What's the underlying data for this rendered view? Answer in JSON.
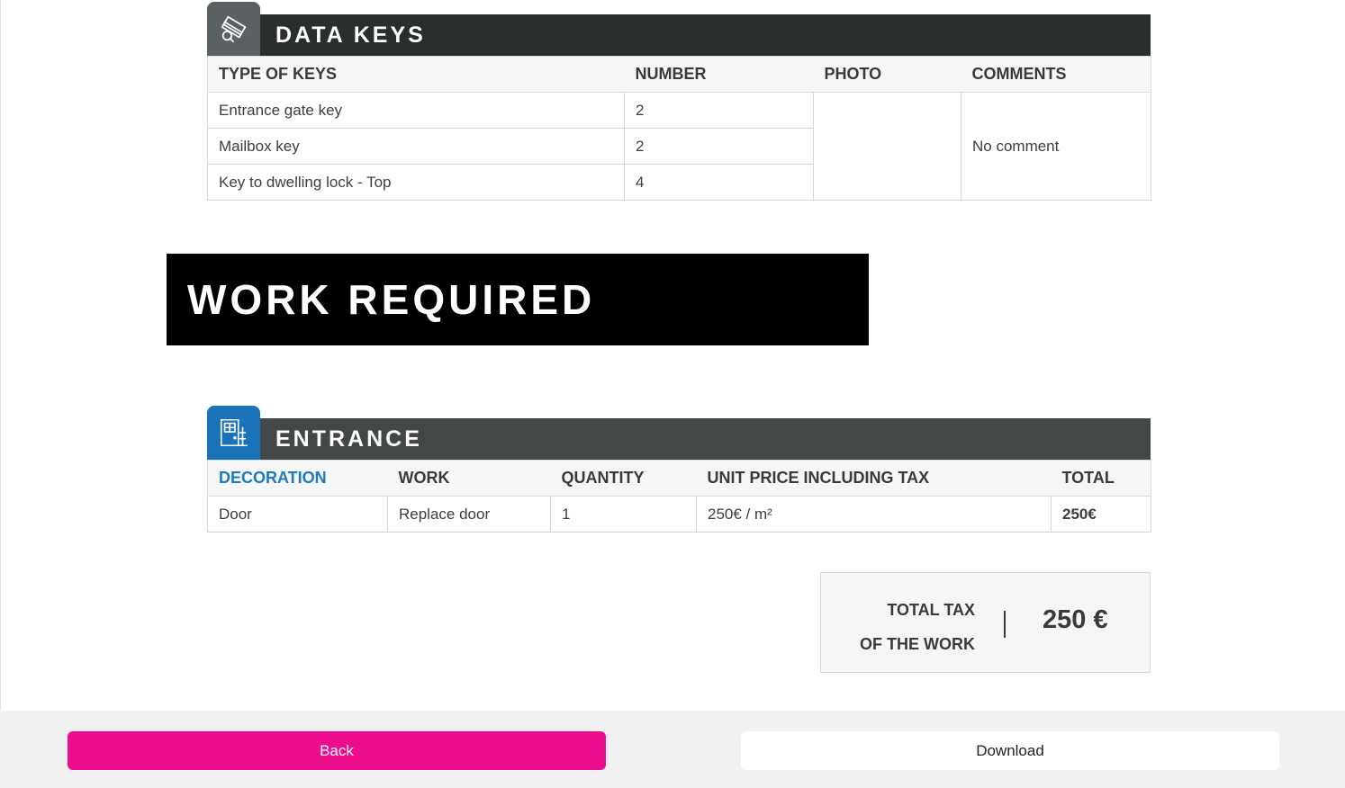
{
  "keys_section": {
    "title": "DATA KEYS",
    "icon": "keys-icon",
    "columns": [
      "TYPE OF KEYS",
      "NUMBER",
      "PHOTO",
      "COMMENTS"
    ],
    "rows": [
      {
        "type": "Entrance gate key",
        "number": "2"
      },
      {
        "type": "Mailbox key",
        "number": "2"
      },
      {
        "type": "Key to dwelling lock - Top",
        "number": "4"
      }
    ],
    "photo": "",
    "comment": "No comment"
  },
  "work_banner": {
    "title": "WORK REQUIRED"
  },
  "entrance_section": {
    "title": "ENTRANCE",
    "icon": "door-icon",
    "columns": [
      "DECORATION",
      "WORK",
      "QUANTITY",
      "UNIT PRICE INCLUDING TAX",
      "TOTAL"
    ],
    "rows": [
      {
        "decoration": "Door",
        "work": "Replace door",
        "quantity": "1",
        "unit_price": "250€ / m²",
        "total": "250€"
      }
    ]
  },
  "total": {
    "label_line1": "TOTAL TAX",
    "label_line2": "OF THE WORK",
    "amount": "250 €"
  },
  "footer": {
    "back_label": "Back",
    "download_label": "Download"
  },
  "colors": {
    "keys_header": "#2b2e2e",
    "keys_icon_bg": "#5b6163",
    "entrance_header": "#434748",
    "entrance_icon_bg": "#1a73b8",
    "accent_blue": "#1e7ab8",
    "back_button": "#ec0c8c"
  }
}
